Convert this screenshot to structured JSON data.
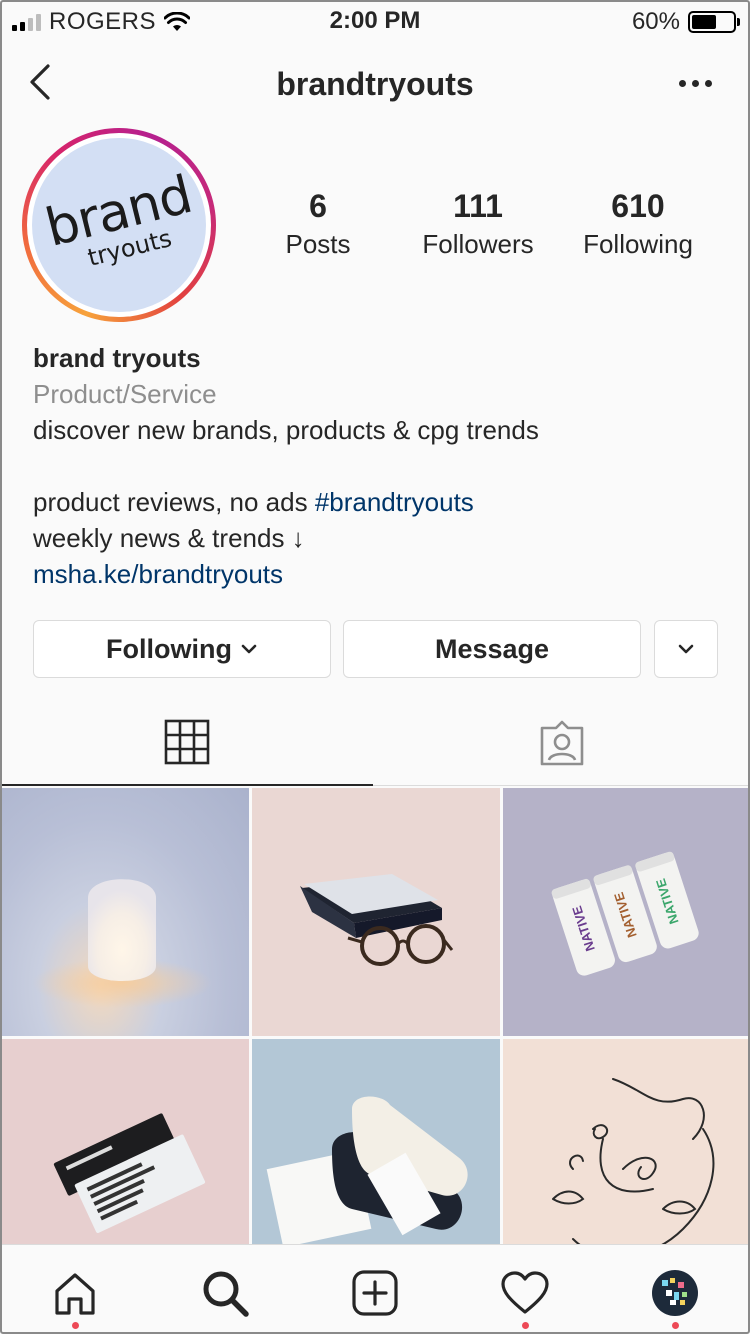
{
  "status_bar": {
    "carrier": "ROGERS",
    "time": "2:00 PM",
    "battery": "60%",
    "battery_level": 0.6,
    "signal_bars": 2
  },
  "header": {
    "username": "brandtryouts",
    "back_icon": "chevron-left-icon",
    "more_icon": "ellipsis-icon"
  },
  "profile": {
    "avatar_text_line1": "brand",
    "avatar_text_line2": "tryouts",
    "stats": [
      {
        "value": "6",
        "label": "Posts"
      },
      {
        "value": "111",
        "label": "Followers"
      },
      {
        "value": "610",
        "label": "Following"
      }
    ],
    "name": "brand tryouts",
    "category": "Product/Service",
    "bio_line1": "discover new brands, products & cpg trends",
    "bio_line2_text": "product reviews, no ads ",
    "bio_hashtag": "#brandtryouts",
    "bio_line3": "weekly news & trends ↓",
    "website": "msha.ke/brandtryouts"
  },
  "actions": {
    "following_label": "Following",
    "message_label": "Message"
  },
  "tabs": [
    {
      "icon": "grid-icon",
      "active": true
    },
    {
      "icon": "tagged-icon",
      "active": false
    }
  ],
  "posts": [
    {
      "subject": "white-glowing-lamp"
    },
    {
      "subject": "glasses-and-case"
    },
    {
      "subject": "native-deodorant-sticks",
      "text": "NATIVE"
    },
    {
      "subject": "protein-bars"
    },
    {
      "subject": "socks-package"
    },
    {
      "subject": "line-art-faces"
    }
  ],
  "nav": [
    {
      "icon": "home-icon",
      "notification": true
    },
    {
      "icon": "search-icon",
      "notification": false
    },
    {
      "icon": "new-post-icon",
      "notification": false
    },
    {
      "icon": "heart-icon",
      "notification": true
    },
    {
      "icon": "profile-avatar",
      "notification": true
    }
  ],
  "colors": {
    "link": "#003569",
    "muted": "#8e8e8e",
    "notification_dot": "#ed4956",
    "text": "#262626"
  }
}
